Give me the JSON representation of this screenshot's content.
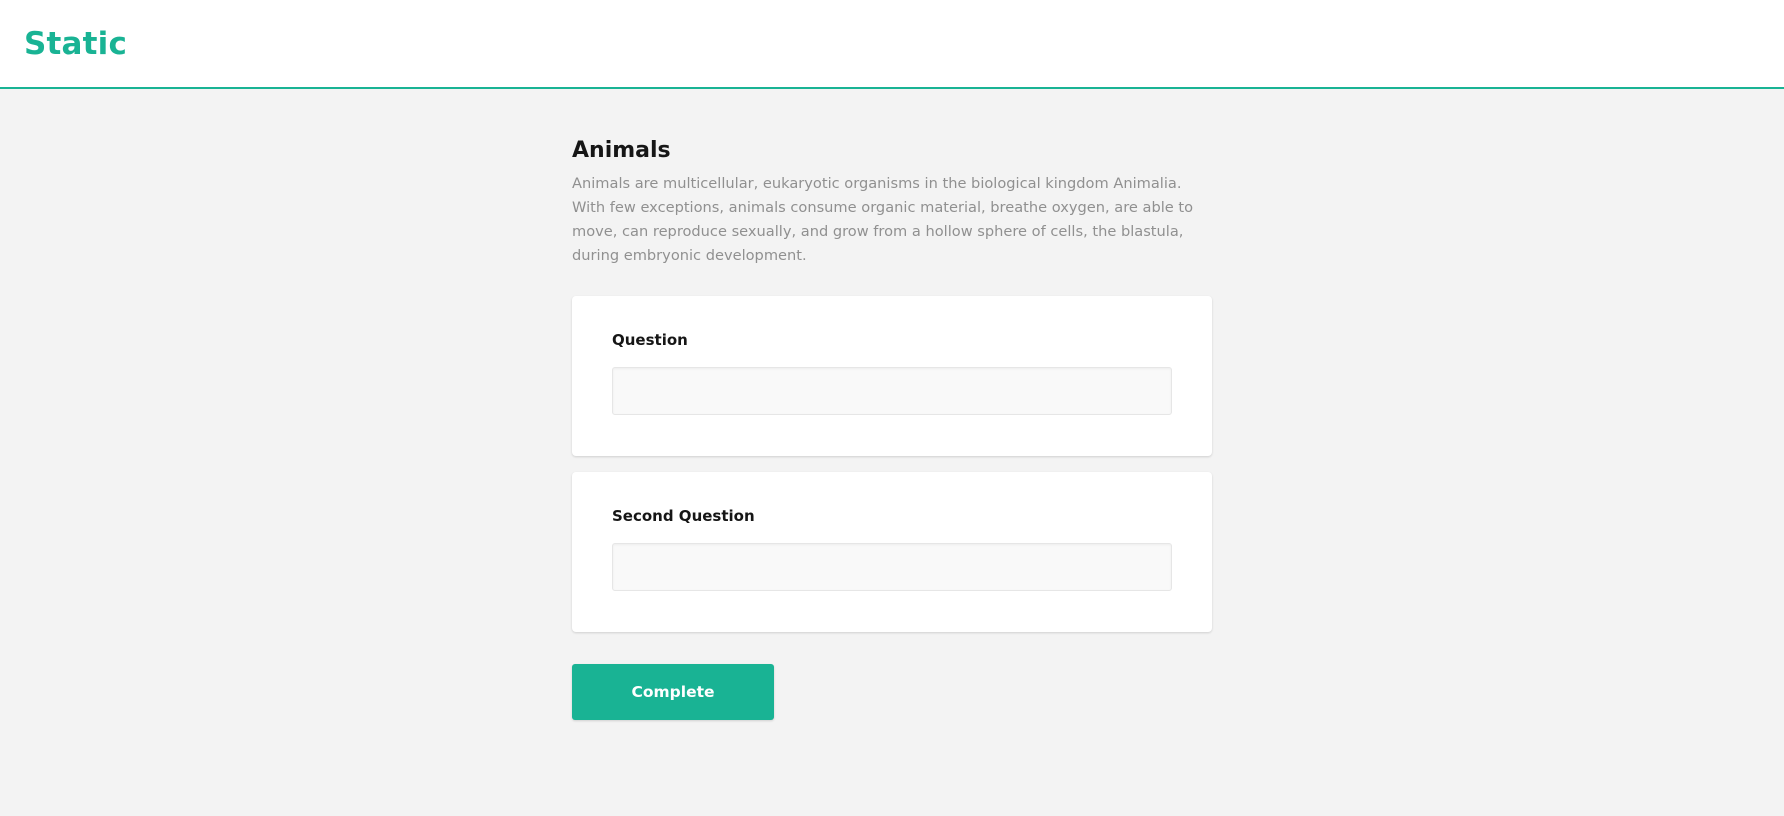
{
  "header": {
    "brand": "Static"
  },
  "survey": {
    "title": "Animals",
    "description": "Animals are multicellular, eukaryotic organisms in the biological kingdom Animalia. With few exceptions, animals consume organic material, breathe oxygen, are able to move, can reproduce sexually, and grow from a hollow sphere of cells, the blastula, during embryonic development.",
    "questions": [
      {
        "label": "Question",
        "value": ""
      },
      {
        "label": "Second Question",
        "value": ""
      }
    ],
    "complete_label": "Complete"
  },
  "colors": {
    "accent": "#19b394",
    "background": "#f3f3f3",
    "panel": "#ffffff",
    "input_bg": "#f9f9f9"
  }
}
